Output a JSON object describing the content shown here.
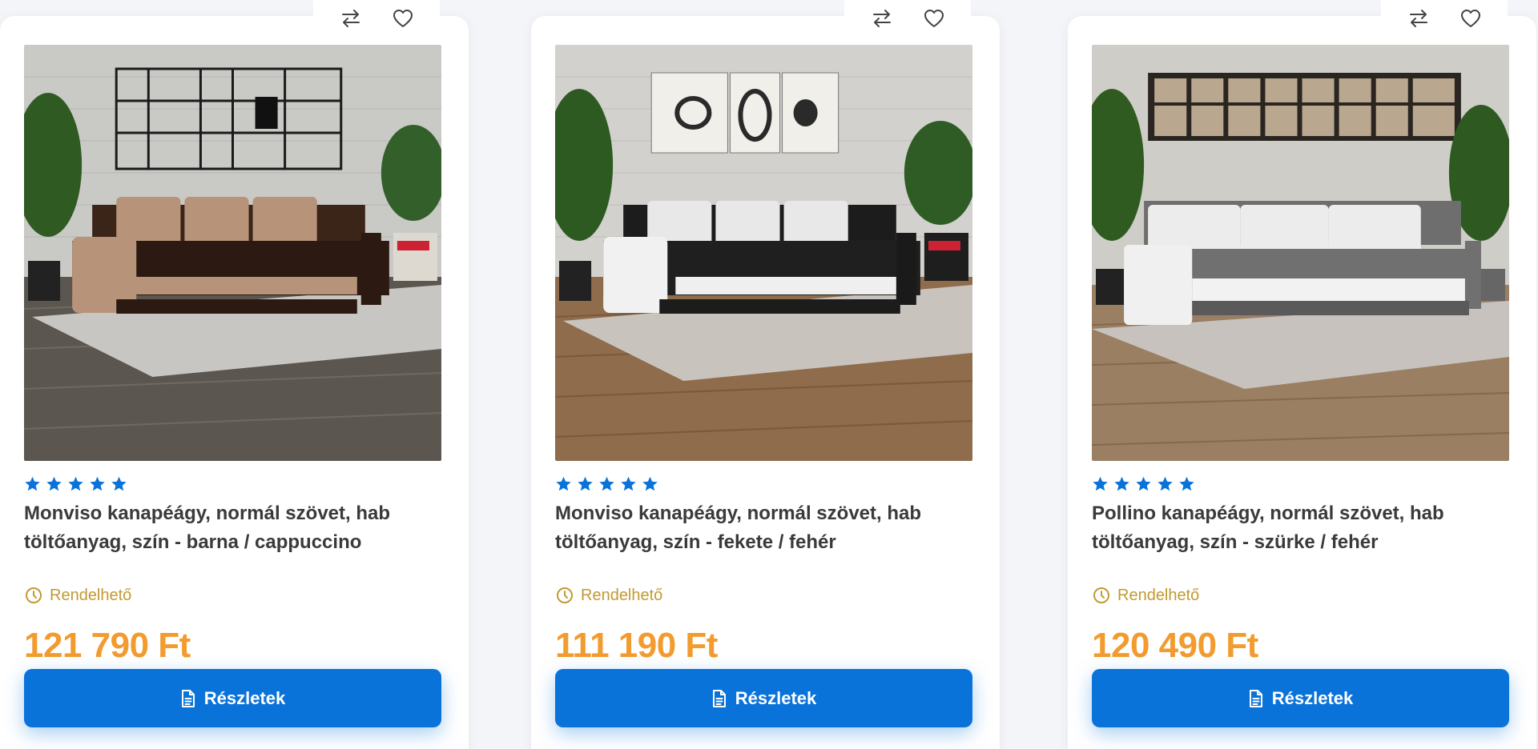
{
  "colors": {
    "accent": "#0a73d9",
    "price": "#f29b2e",
    "availability": "#c29a32",
    "star": "#0a73d9"
  },
  "icons": {
    "compare": "compare-arrows-icon",
    "wishlist": "heart-icon",
    "availability": "clock-icon",
    "details": "document-icon",
    "rating": "star-icon"
  },
  "products": [
    {
      "rating": 5,
      "title": "Monviso kanapéágy, normál szövet, hab töltőanyag, szín - barna / cappuccino",
      "availability": "Rendelhető",
      "price": "121 790 Ft",
      "button_label": "Részletek"
    },
    {
      "rating": 5,
      "title": "Monviso kanapéágy, normál szövet, hab töltőanyag, szín - fekete / fehér",
      "availability": "Rendelhető",
      "price": "111 190 Ft",
      "button_label": "Részletek"
    },
    {
      "rating": 5,
      "title": "Pollino kanapéágy, normál szövet, hab töltőanyag, szín - szürke / fehér",
      "availability": "Rendelhető",
      "price": "120 490 Ft",
      "button_label": "Részletek"
    }
  ]
}
